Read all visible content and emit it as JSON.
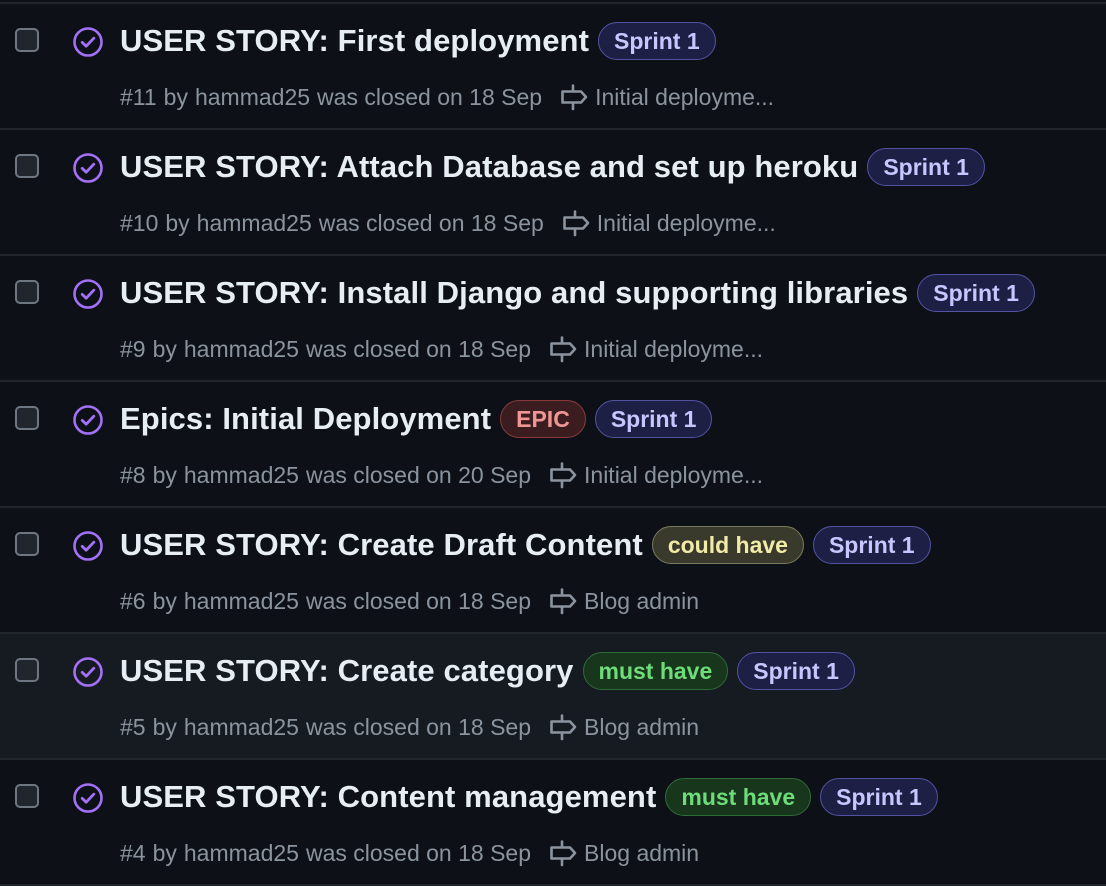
{
  "colors": {
    "background": "#0d1117",
    "row_hover_background": "#161b22",
    "closed_icon": "#a371f7",
    "muted_text": "#8b949e",
    "title_text": "#e6edf3",
    "divider": "#21262d"
  },
  "issues": [
    {
      "title": "USER STORY: First deployment",
      "number": "#11",
      "by": "by",
      "author": "hammad25",
      "closed_text": "was closed on 18 Sep",
      "milestone": "Initial deployme...",
      "status_icon": "issue-closed-icon",
      "labels": [
        {
          "text": "Sprint 1",
          "bg": "#1d1f45",
          "border": "#5253a3",
          "fg": "#c9c5ff"
        }
      ]
    },
    {
      "title": "USER STORY: Attach Database and set up heroku",
      "number": "#10",
      "by": "by",
      "author": "hammad25",
      "closed_text": "was closed on 18 Sep",
      "milestone": "Initial deployme...",
      "status_icon": "issue-closed-icon",
      "labels": [
        {
          "text": "Sprint 1",
          "bg": "#1d1f45",
          "border": "#5253a3",
          "fg": "#c9c5ff"
        }
      ]
    },
    {
      "title": "USER STORY: Install Django and supporting libraries",
      "number": "#9",
      "by": "by",
      "author": "hammad25",
      "closed_text": "was closed on 18 Sep",
      "milestone": "Initial deployme...",
      "status_icon": "issue-closed-icon",
      "labels": [
        {
          "text": "Sprint 1",
          "bg": "#1d1f45",
          "border": "#5253a3",
          "fg": "#c9c5ff"
        }
      ]
    },
    {
      "title": "Epics: Initial Deployment",
      "number": "#8",
      "by": "by",
      "author": "hammad25",
      "closed_text": "was closed on 20 Sep",
      "milestone": "Initial deployme...",
      "status_icon": "issue-closed-icon",
      "labels": [
        {
          "text": "EPIC",
          "bg": "#3b1d1f",
          "border": "#8a3a3d",
          "fg": "#f09595"
        },
        {
          "text": "Sprint 1",
          "bg": "#1d1f45",
          "border": "#5253a3",
          "fg": "#c9c5ff"
        }
      ]
    },
    {
      "title": "USER STORY: Create Draft Content",
      "number": "#6",
      "by": "by",
      "author": "hammad25",
      "closed_text": "was closed on 18 Sep",
      "milestone": "Blog admin",
      "status_icon": "issue-closed-icon",
      "labels": [
        {
          "text": "could have",
          "bg": "#3a3a2c",
          "border": "#7a7a5c",
          "fg": "#f2eba8"
        },
        {
          "text": "Sprint 1",
          "bg": "#1d1f45",
          "border": "#5253a3",
          "fg": "#c9c5ff"
        }
      ]
    },
    {
      "title": "USER STORY: Create category",
      "number": "#5",
      "by": "by",
      "author": "hammad25",
      "closed_text": "was closed on 18 Sep",
      "milestone": "Blog admin",
      "status_icon": "issue-closed-icon",
      "hovered": true,
      "labels": [
        {
          "text": "must have",
          "bg": "#17361c",
          "border": "#2e6b37",
          "fg": "#6fdc7a"
        },
        {
          "text": "Sprint 1",
          "bg": "#1d1f45",
          "border": "#5253a3",
          "fg": "#c9c5ff"
        }
      ]
    },
    {
      "title": "USER STORY: Content management",
      "number": "#4",
      "by": "by",
      "author": "hammad25",
      "closed_text": "was closed on 18 Sep",
      "milestone": "Blog admin",
      "status_icon": "issue-closed-icon",
      "labels": [
        {
          "text": "must have",
          "bg": "#17361c",
          "border": "#2e6b37",
          "fg": "#6fdc7a"
        },
        {
          "text": "Sprint 1",
          "bg": "#1d1f45",
          "border": "#5253a3",
          "fg": "#c9c5ff"
        }
      ]
    }
  ]
}
